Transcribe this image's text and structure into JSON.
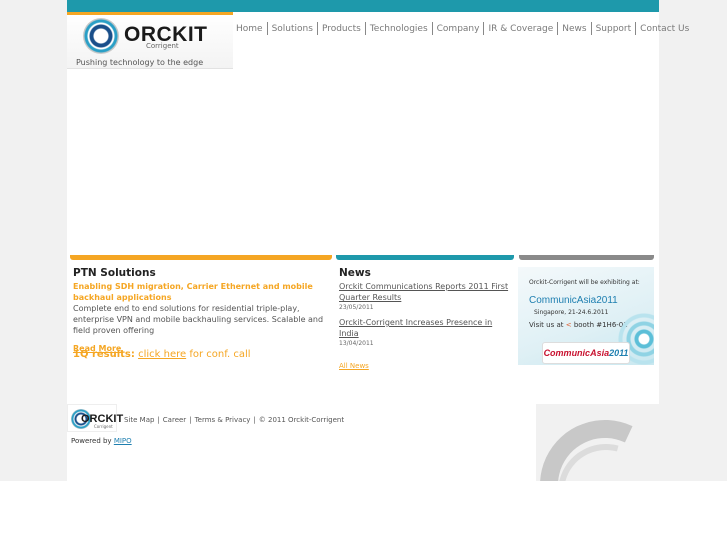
{
  "brand": {
    "logo_text": "ORCKIT",
    "logo_sub": "Corrigent",
    "tagline": "Pushing technology to the edge",
    "accent_color": "#f5a623",
    "teal_color": "#1e99ab"
  },
  "nav": {
    "items": [
      "Home",
      "Solutions",
      "Products",
      "Technologies",
      "Company",
      "IR & Coverage",
      "News",
      "Support",
      "Contact Us"
    ]
  },
  "ptn": {
    "heading": "PTN Solutions",
    "tagline": "Enabling SDH migration, Carrier Ethernet and mobile backhaul applications",
    "description": "Complete end to end solutions for residential triple-play, enterprise VPN and mobile backhauling services. Scalable and field proven offering",
    "read_more": "Read More",
    "results_label": "1Q results:",
    "results_link": "click here",
    "results_suffix": "for conf. call"
  },
  "news": {
    "heading": "News",
    "items": [
      {
        "title": "Orckit Communications Reports 2011 First Quarter Results",
        "date": "23/05/2011"
      },
      {
        "title": "Orckit-Corrigent Increases Presence in India",
        "date": "13/04/2011"
      }
    ],
    "all_link": "All News"
  },
  "banner": {
    "line1": "Orckit-Corrigent will be exhibiting at:",
    "event": "CommunicAsia2011",
    "location": "Singapore, 21-24.6.2011",
    "visit_prefix": "Visit us at",
    "booth": "booth #1H6-01",
    "logo_text": "CommunicAsia",
    "logo_year": "2011"
  },
  "footer": {
    "logo_text": "ORCKIT",
    "logo_sub": "Corrigent",
    "links": [
      "Site Map",
      "Career",
      "Terms & Privacy"
    ],
    "copyright": "© 2011 Orckit-Corrigent",
    "powered_label": "Powered by",
    "powered_link": "MIPO"
  }
}
